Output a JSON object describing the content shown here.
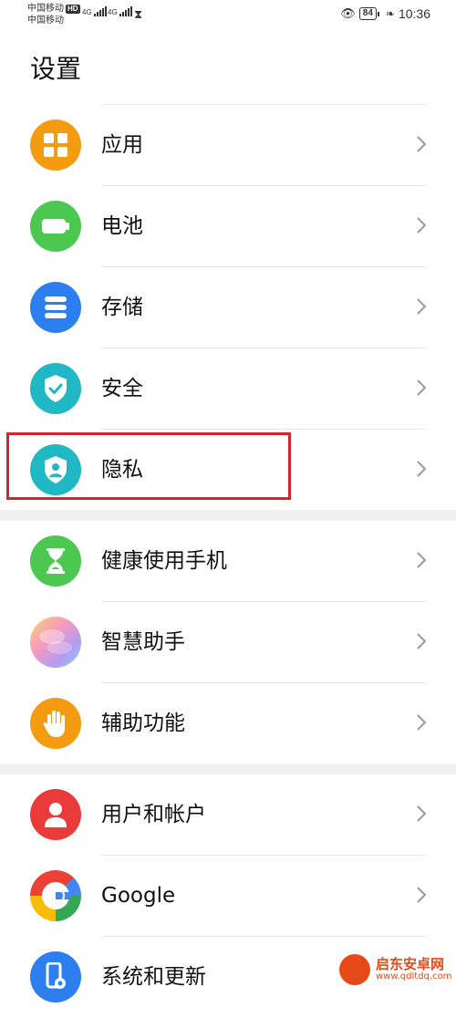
{
  "status_bar": {
    "carrier1": "中国移动",
    "carrier2": "中国移动",
    "hd": "HD",
    "signal1": "4G",
    "signal2": "4G",
    "battery": "84",
    "time": "10:36"
  },
  "page_title": "设置",
  "rows": [
    {
      "label": "应用",
      "icon": "apps-icon",
      "color": "#f39c12"
    },
    {
      "label": "电池",
      "icon": "battery-icon",
      "color": "#4cc74f"
    },
    {
      "label": "存储",
      "icon": "storage-icon",
      "color": "#2d7ff0"
    },
    {
      "label": "安全",
      "icon": "shield-check-icon",
      "color": "#1fb8c4"
    },
    {
      "label": "隐私",
      "icon": "privacy-shield-icon",
      "color": "#1fb8c4"
    },
    {
      "label": "健康使用手机",
      "icon": "hourglass-icon",
      "color": "#4cc74f"
    },
    {
      "label": "智慧助手",
      "icon": "assistant-orb-icon",
      "color": "#e5a0d8"
    },
    {
      "label": "辅助功能",
      "icon": "hand-icon",
      "color": "#f39c12"
    },
    {
      "label": "用户和帐户",
      "icon": "user-icon",
      "color": "#ea3b3b"
    },
    {
      "label": "Google",
      "icon": "google-icon",
      "color": "#4285f4"
    },
    {
      "label": "系统和更新",
      "icon": "phone-settings-icon",
      "color": "#2d7ff0"
    }
  ],
  "watermark": {
    "text1": "启东安卓网",
    "text2": "www.qdltdq.com"
  }
}
